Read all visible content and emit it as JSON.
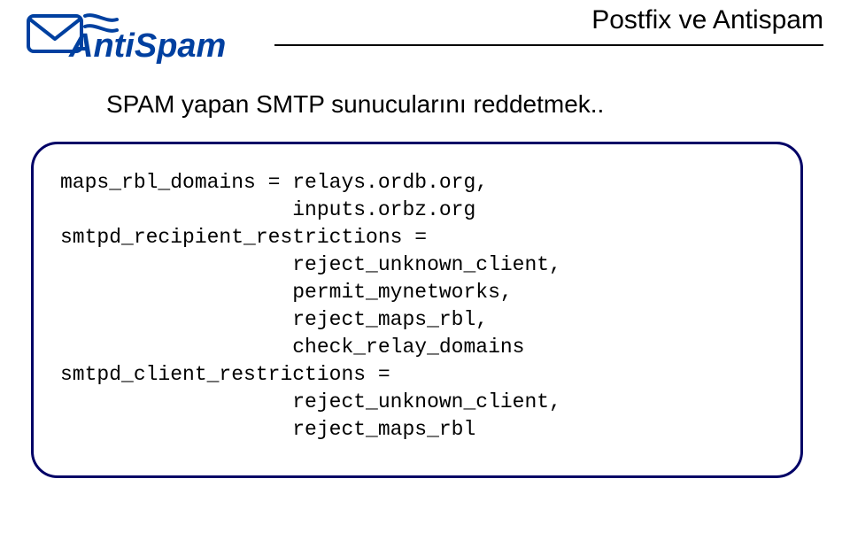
{
  "header": {
    "logo_text": "AntiSpam",
    "title": "Postfix ve Antispam"
  },
  "subtitle": "SPAM yapan SMTP sunucularını reddetmek..",
  "code": {
    "l1": "maps_rbl_domains = relays.ordb.org,",
    "l2": "                   inputs.orbz.org",
    "l3": "smtpd_recipient_restrictions =",
    "l4": "                   reject_unknown_client,",
    "l5": "                   permit_mynetworks,",
    "l6": "                   reject_maps_rbl,",
    "l7": "                   check_relay_domains",
    "l8": "smtpd_client_restrictions =",
    "l9": "                   reject_unknown_client,",
    "l10": "                   reject_maps_rbl"
  }
}
